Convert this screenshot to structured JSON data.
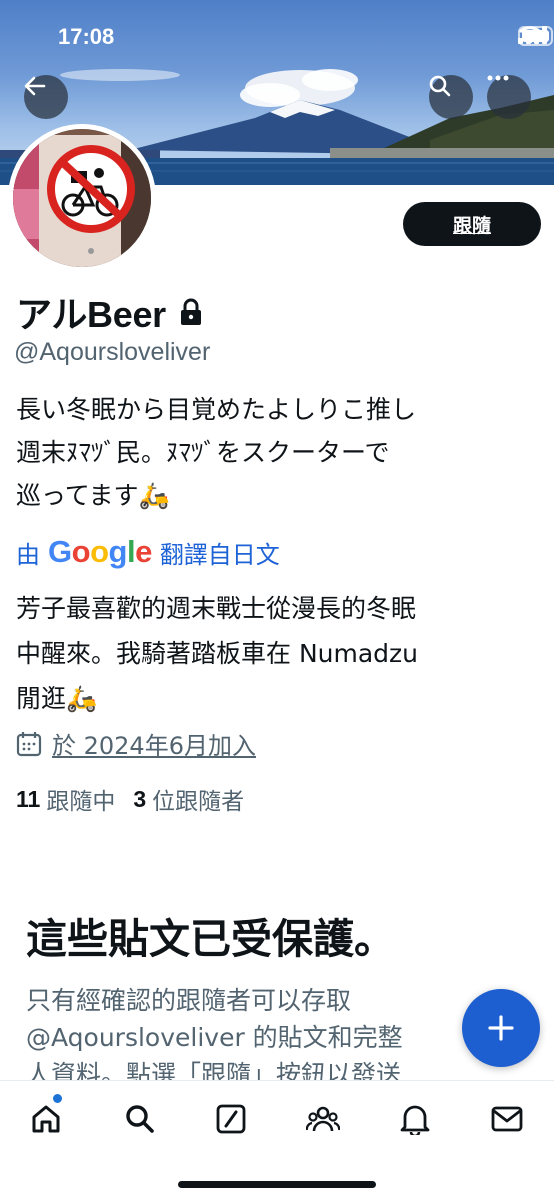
{
  "status_bar": {
    "time": "17:08"
  },
  "profile": {
    "display_name": "アルBeer",
    "handle": "@Aqoursloveliver",
    "follow_label": "跟隨",
    "bio_lines": [
      "長い冬眠から目覚めたよしりこ推し",
      "週末ﾇﾏﾂﾞ民。ﾇﾏﾂﾞをスクーターで",
      "巡ってます🛵"
    ],
    "translate": {
      "by": "由",
      "provider": "Google",
      "link": "翻譯自日文"
    },
    "bio_translated_lines": [
      "芳子最喜歡的週末戰士從漫長的冬眠",
      "中醒來。我騎著踏板車在 Numadzu",
      "閒逛🛵"
    ],
    "joined": "於 2024年6月加入",
    "following_count": "11",
    "following_label": "跟隨中",
    "followers_count": "3",
    "followers_label": "位跟隨者"
  },
  "protected": {
    "title": "這些貼文已受保護。",
    "body_lines": [
      "只有經確認的跟隨者可以存取",
      "@Aqoursloveliver 的貼文和完整",
      "人資料。點選「跟隨」按鈕以發送"
    ]
  },
  "icons": [
    "back-arrow-icon",
    "search-icon",
    "more-icon",
    "lock-icon",
    "calendar-icon",
    "plus-icon",
    "home-icon",
    "explore-icon",
    "grok-icon",
    "communities-icon",
    "notifications-icon",
    "messages-icon"
  ],
  "colors": {
    "accent": "#1d5fd0",
    "link": "#1d63d6",
    "text": "#0f1419",
    "muted": "#536471"
  }
}
